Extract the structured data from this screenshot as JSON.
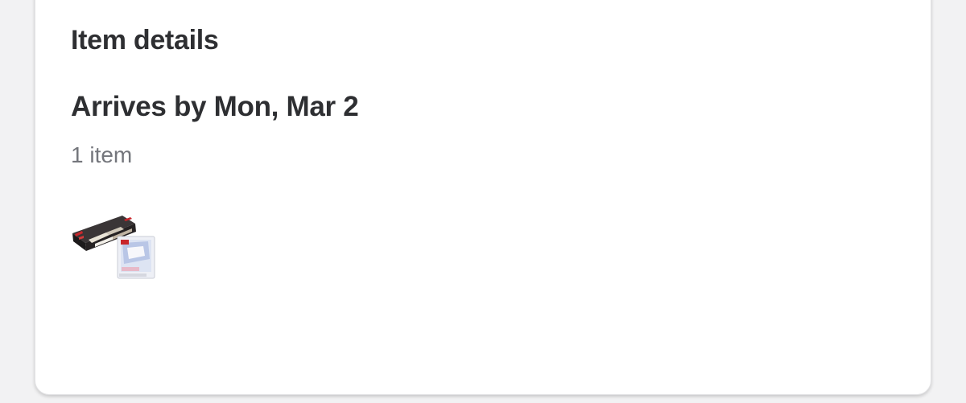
{
  "item_details": {
    "title": "Item details"
  },
  "shipment": {
    "arrival_label": "Arrives by Mon, Mar 2",
    "item_count": "1 item",
    "items": [
      {
        "image_icon": "product-bundle-thumbnail"
      }
    ]
  }
}
